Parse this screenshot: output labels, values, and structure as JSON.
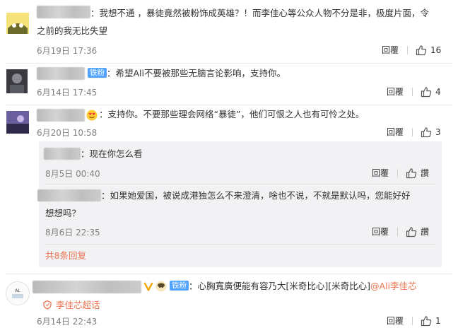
{
  "comments": [
    {
      "text_line1": "：我想不通 ，暴徒竟然被粉饰成英雄？！而李佳心等公众人物不分是非，极度片面，令",
      "text_line2": "之前的我无比失望",
      "time": "6月19日 17:36",
      "reply_label": "回覆",
      "likes": "16"
    },
    {
      "badge": "铁粉",
      "text": "：希望Ali不要被那些无脑言论影响，支持你。",
      "time": "6月14日 17:45",
      "reply_label": "回覆",
      "likes": "4"
    },
    {
      "text": "：支持你。不要那些理会网络“暴徒”，他们可恨之人也有可怜之处。",
      "time": "6月20日 10:58",
      "reply_label": "回覆",
      "likes": "3"
    }
  ],
  "replies": [
    {
      "text": "：现在你怎么看",
      "time": "8月5日 00:40",
      "reply_label": "回覆",
      "like_label": "讚"
    },
    {
      "text_line1": "：如果她爱国，被说成港独怎么不来澄清，啥也不说，不就是默认吗，您能好好",
      "text_line2": "想想吗？",
      "time": "8月6日 22:35",
      "reply_label": "回覆",
      "like_label": "讚"
    }
  ],
  "more_replies": "共8条回复",
  "last_comment": {
    "badge": "铁粉",
    "text": "：心胸寬廣便能有容乃大[米奇比心][米奇比心]",
    "mention": "@Ali李佳芯",
    "supertopic": "李佳芯超话",
    "time": "6月14日 22:43",
    "reply_label": "回覆",
    "likes": "1"
  },
  "colors": {
    "accent_orange": "#eb7350",
    "badge_blue": "#51a3ff",
    "meta_gray": "#808080"
  }
}
